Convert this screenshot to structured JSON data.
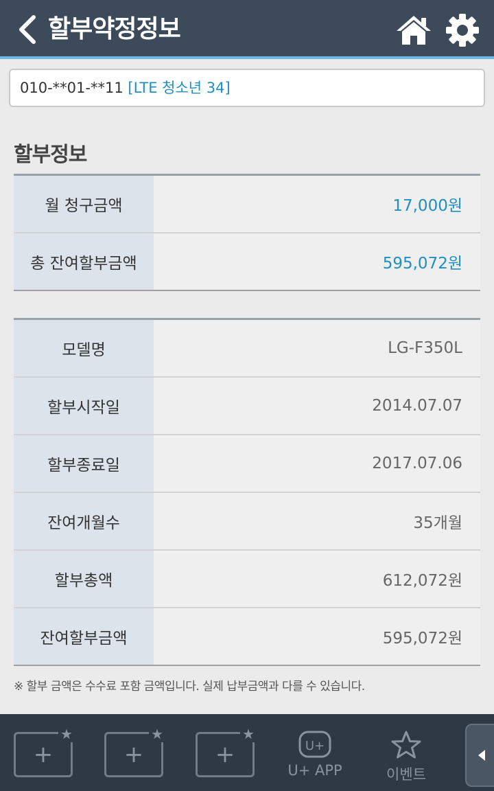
{
  "header": {
    "title": "할부약정정보",
    "icons": {
      "back": "chevron-left-icon",
      "home": "home-icon",
      "settings": "gear-icon"
    }
  },
  "line": {
    "number": "010-**01-**11",
    "plan": "[LTE 청소년 34]"
  },
  "section": {
    "title": "할부정보"
  },
  "billing": {
    "rows": [
      {
        "label": "월 청구금액",
        "value": "17,000원"
      },
      {
        "label": "총 잔여할부금액",
        "value": "595,072원"
      }
    ]
  },
  "device": {
    "rows": [
      {
        "label": "모델명",
        "value": "LG-F350L"
      },
      {
        "label": "할부시작일",
        "value": "2014.07.07"
      },
      {
        "label": "할부종료일",
        "value": "2017.07.06"
      },
      {
        "label": "잔여개월수",
        "value": "35개월"
      },
      {
        "label": "할부총액",
        "value": "612,072원"
      },
      {
        "label": "잔여할부금액",
        "value": "595,072원"
      }
    ]
  },
  "notice": "※ 할부 금액은 수수료 포함 금액입니다. 실제 납부금액과 다를 수 있습니다.",
  "bottom_bar": {
    "slots": [
      {
        "symbol": "+",
        "icon": "add-shortcut-icon"
      },
      {
        "symbol": "+",
        "icon": "add-shortcut-icon"
      },
      {
        "symbol": "+",
        "icon": "add-shortcut-icon"
      }
    ],
    "uplus_label": "U+ APP",
    "uplus_logo": "U+",
    "event_label": "이벤트"
  },
  "colors": {
    "header_bg": "#3d4a59",
    "accent": "#1e8fbf",
    "label_bg": "#dde3ea",
    "bottom_bg": "#2f3945"
  }
}
